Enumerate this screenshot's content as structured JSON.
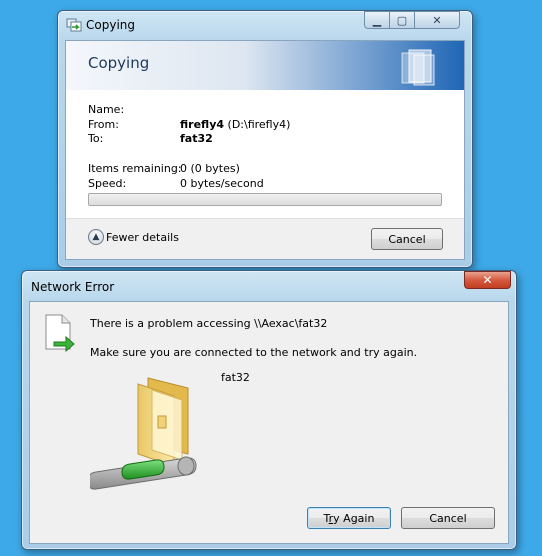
{
  "copy_window": {
    "title": "Copying",
    "header": "Copying",
    "name_label": "Name:",
    "from_label": "From:",
    "from_name": "firefly4",
    "from_path": "(D:\\firefly4)",
    "to_label": "To:",
    "to_name": "fat32",
    "items_label": "Items remaining:",
    "items_value": "0 (0 bytes)",
    "speed_label": "Speed:",
    "speed_value": "0 bytes/second",
    "progress_percent": 0,
    "fewer_details_label": "Fewer details",
    "cancel_label": "Cancel"
  },
  "error_window": {
    "title": "Network Error",
    "message": "There is a problem accessing \\\\Aexac\\fat32",
    "hint": "Make sure you are connected to the network and try again.",
    "folder_name": "fat32",
    "try_again_label_prefix": "T",
    "try_again_label_accel": "r",
    "try_again_label_rest": "y Again",
    "cancel_label": "Cancel"
  },
  "icons": {
    "copy_title": "copy-files-icon",
    "copy_header_art": "document-stack-icon",
    "fewer_details": "chevron-up-circle-icon",
    "error_document": "network-document-icon",
    "error_folder": "network-folder-icon"
  },
  "colors": {
    "desktop": "#3ea9e8",
    "close_button": "#c94a2f",
    "header_accent": "#1f66b5"
  }
}
